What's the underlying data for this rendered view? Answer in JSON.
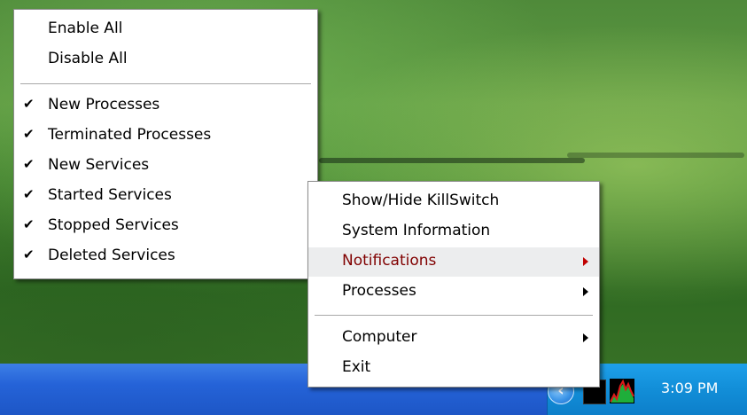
{
  "submenu": {
    "items": [
      {
        "label": "Enable All",
        "checked": false
      },
      {
        "label": "Disable All",
        "checked": false
      },
      {
        "label": "New Processes",
        "checked": true
      },
      {
        "label": "Terminated Processes",
        "checked": true
      },
      {
        "label": "New Services",
        "checked": true
      },
      {
        "label": "Started Services",
        "checked": true
      },
      {
        "label": "Stopped Services",
        "checked": true
      },
      {
        "label": "Deleted Services",
        "checked": true
      }
    ]
  },
  "context_menu": {
    "items": [
      {
        "label": "Show/Hide KillSwitch",
        "has_submenu": false
      },
      {
        "label": "System Information",
        "has_submenu": false
      },
      {
        "label": "Notifications",
        "has_submenu": true,
        "highlighted": true
      },
      {
        "label": "Processes",
        "has_submenu": true
      },
      {
        "label": "Computer",
        "has_submenu": true
      },
      {
        "label": "Exit",
        "has_submenu": false
      }
    ]
  },
  "taskbar": {
    "clock": "3:09 PM",
    "tray_icons": [
      "show-hidden-icons-chevron-icon",
      "killswitch-tray-icon",
      "performance-graph-tray-icon"
    ]
  },
  "colors": {
    "taskbar_blue": "#245edb",
    "tray_blue": "#128ed8",
    "highlight_text": "#800000",
    "highlight_bg": "#ecedee"
  }
}
